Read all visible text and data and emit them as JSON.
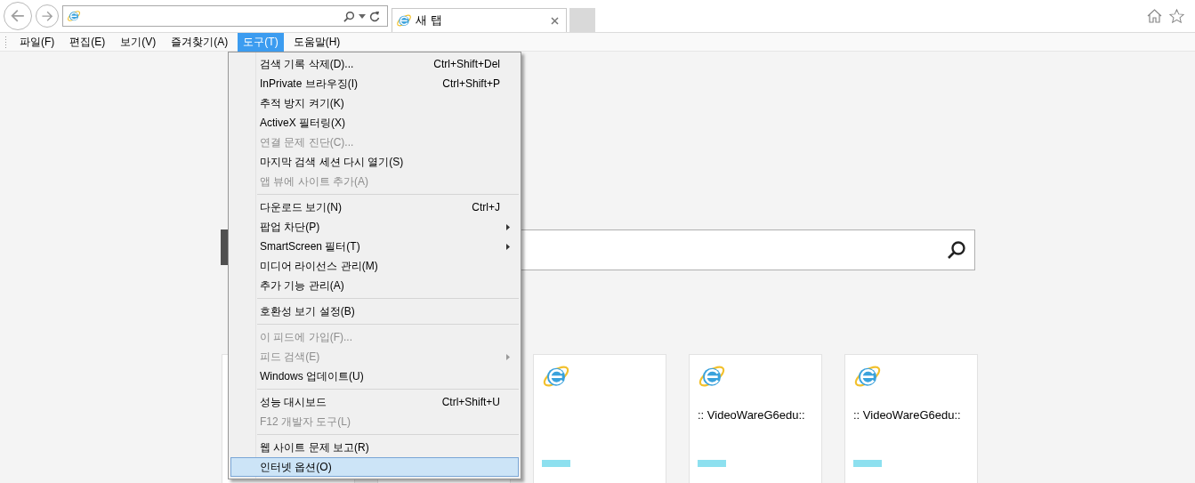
{
  "toolbar": {
    "tab": {
      "label": "새 탭",
      "selected": true
    }
  },
  "menubar": [
    {
      "label": "파일(F)",
      "selected": false
    },
    {
      "label": "편집(E)",
      "selected": false
    },
    {
      "label": "보기(V)",
      "selected": false
    },
    {
      "label": "즐겨찾기(A)",
      "selected": false
    },
    {
      "label": "도구(T)",
      "selected": true
    },
    {
      "label": "도움말(H)",
      "selected": false
    }
  ],
  "menu": [
    {
      "kind": "item",
      "label": "검색 기록 삭제(D)...",
      "shortcut": "Ctrl+Shift+Del",
      "disabled": false,
      "submenu": false,
      "selected": false
    },
    {
      "kind": "item",
      "label": "InPrivate 브라우징(I)",
      "shortcut": "Ctrl+Shift+P",
      "disabled": false,
      "submenu": false,
      "selected": false
    },
    {
      "kind": "item",
      "label": "추적 방지 켜기(K)",
      "disabled": false,
      "submenu": false,
      "selected": false
    },
    {
      "kind": "item",
      "label": "ActiveX 필터링(X)",
      "disabled": false,
      "submenu": false,
      "selected": false
    },
    {
      "kind": "item",
      "label": "연결 문제 진단(C)...",
      "disabled": true,
      "submenu": false,
      "selected": false
    },
    {
      "kind": "item",
      "label": "마지막 검색 세션 다시 열기(S)",
      "disabled": false,
      "submenu": false,
      "selected": false
    },
    {
      "kind": "item",
      "label": "앱 뷰에 사이트 추가(A)",
      "disabled": true,
      "submenu": false,
      "selected": false
    },
    {
      "kind": "separator"
    },
    {
      "kind": "item",
      "label": "다운로드 보기(N)",
      "shortcut": "Ctrl+J",
      "disabled": false,
      "submenu": false,
      "selected": false
    },
    {
      "kind": "item",
      "label": "팝업 차단(P)",
      "disabled": false,
      "submenu": true,
      "selected": false
    },
    {
      "kind": "item",
      "label": "SmartScreen 필터(T)",
      "disabled": false,
      "submenu": true,
      "selected": false
    },
    {
      "kind": "item",
      "label": "미디어 라이선스 관리(M)",
      "disabled": false,
      "submenu": false,
      "selected": false
    },
    {
      "kind": "item",
      "label": "추가 기능 관리(A)",
      "disabled": false,
      "submenu": false,
      "selected": false
    },
    {
      "kind": "separator"
    },
    {
      "kind": "item",
      "label": "호환성 보기 설정(B)",
      "disabled": false,
      "submenu": false,
      "selected": false
    },
    {
      "kind": "separator"
    },
    {
      "kind": "item",
      "label": "이 피드에 가입(F)...",
      "disabled": true,
      "submenu": false,
      "selected": false
    },
    {
      "kind": "item",
      "label": "피드 검색(E)",
      "disabled": true,
      "submenu": true,
      "selected": false
    },
    {
      "kind": "item",
      "label": "Windows 업데이트(U)",
      "disabled": false,
      "submenu": false,
      "selected": false
    },
    {
      "kind": "separator"
    },
    {
      "kind": "item",
      "label": "성능 대시보드",
      "shortcut": "Ctrl+Shift+U",
      "disabled": false,
      "submenu": false,
      "selected": false
    },
    {
      "kind": "item",
      "label": "F12 개발자 도구(L)",
      "disabled": true,
      "submenu": false,
      "selected": false
    },
    {
      "kind": "separator"
    },
    {
      "kind": "item",
      "label": "웹 사이트 문제 보고(R)",
      "disabled": false,
      "submenu": false,
      "selected": false
    },
    {
      "kind": "item",
      "label": "인터넷 옵션(O)",
      "disabled": false,
      "submenu": false,
      "selected": true
    }
  ],
  "tiles": [
    {
      "kind": "blank"
    },
    {
      "kind": "blank"
    },
    {
      "kind": "site"
    },
    {
      "kind": "site",
      "title": ":: VideoWareG6edu::"
    },
    {
      "kind": "site",
      "title": ":: VideoWareG6edu::"
    }
  ]
}
